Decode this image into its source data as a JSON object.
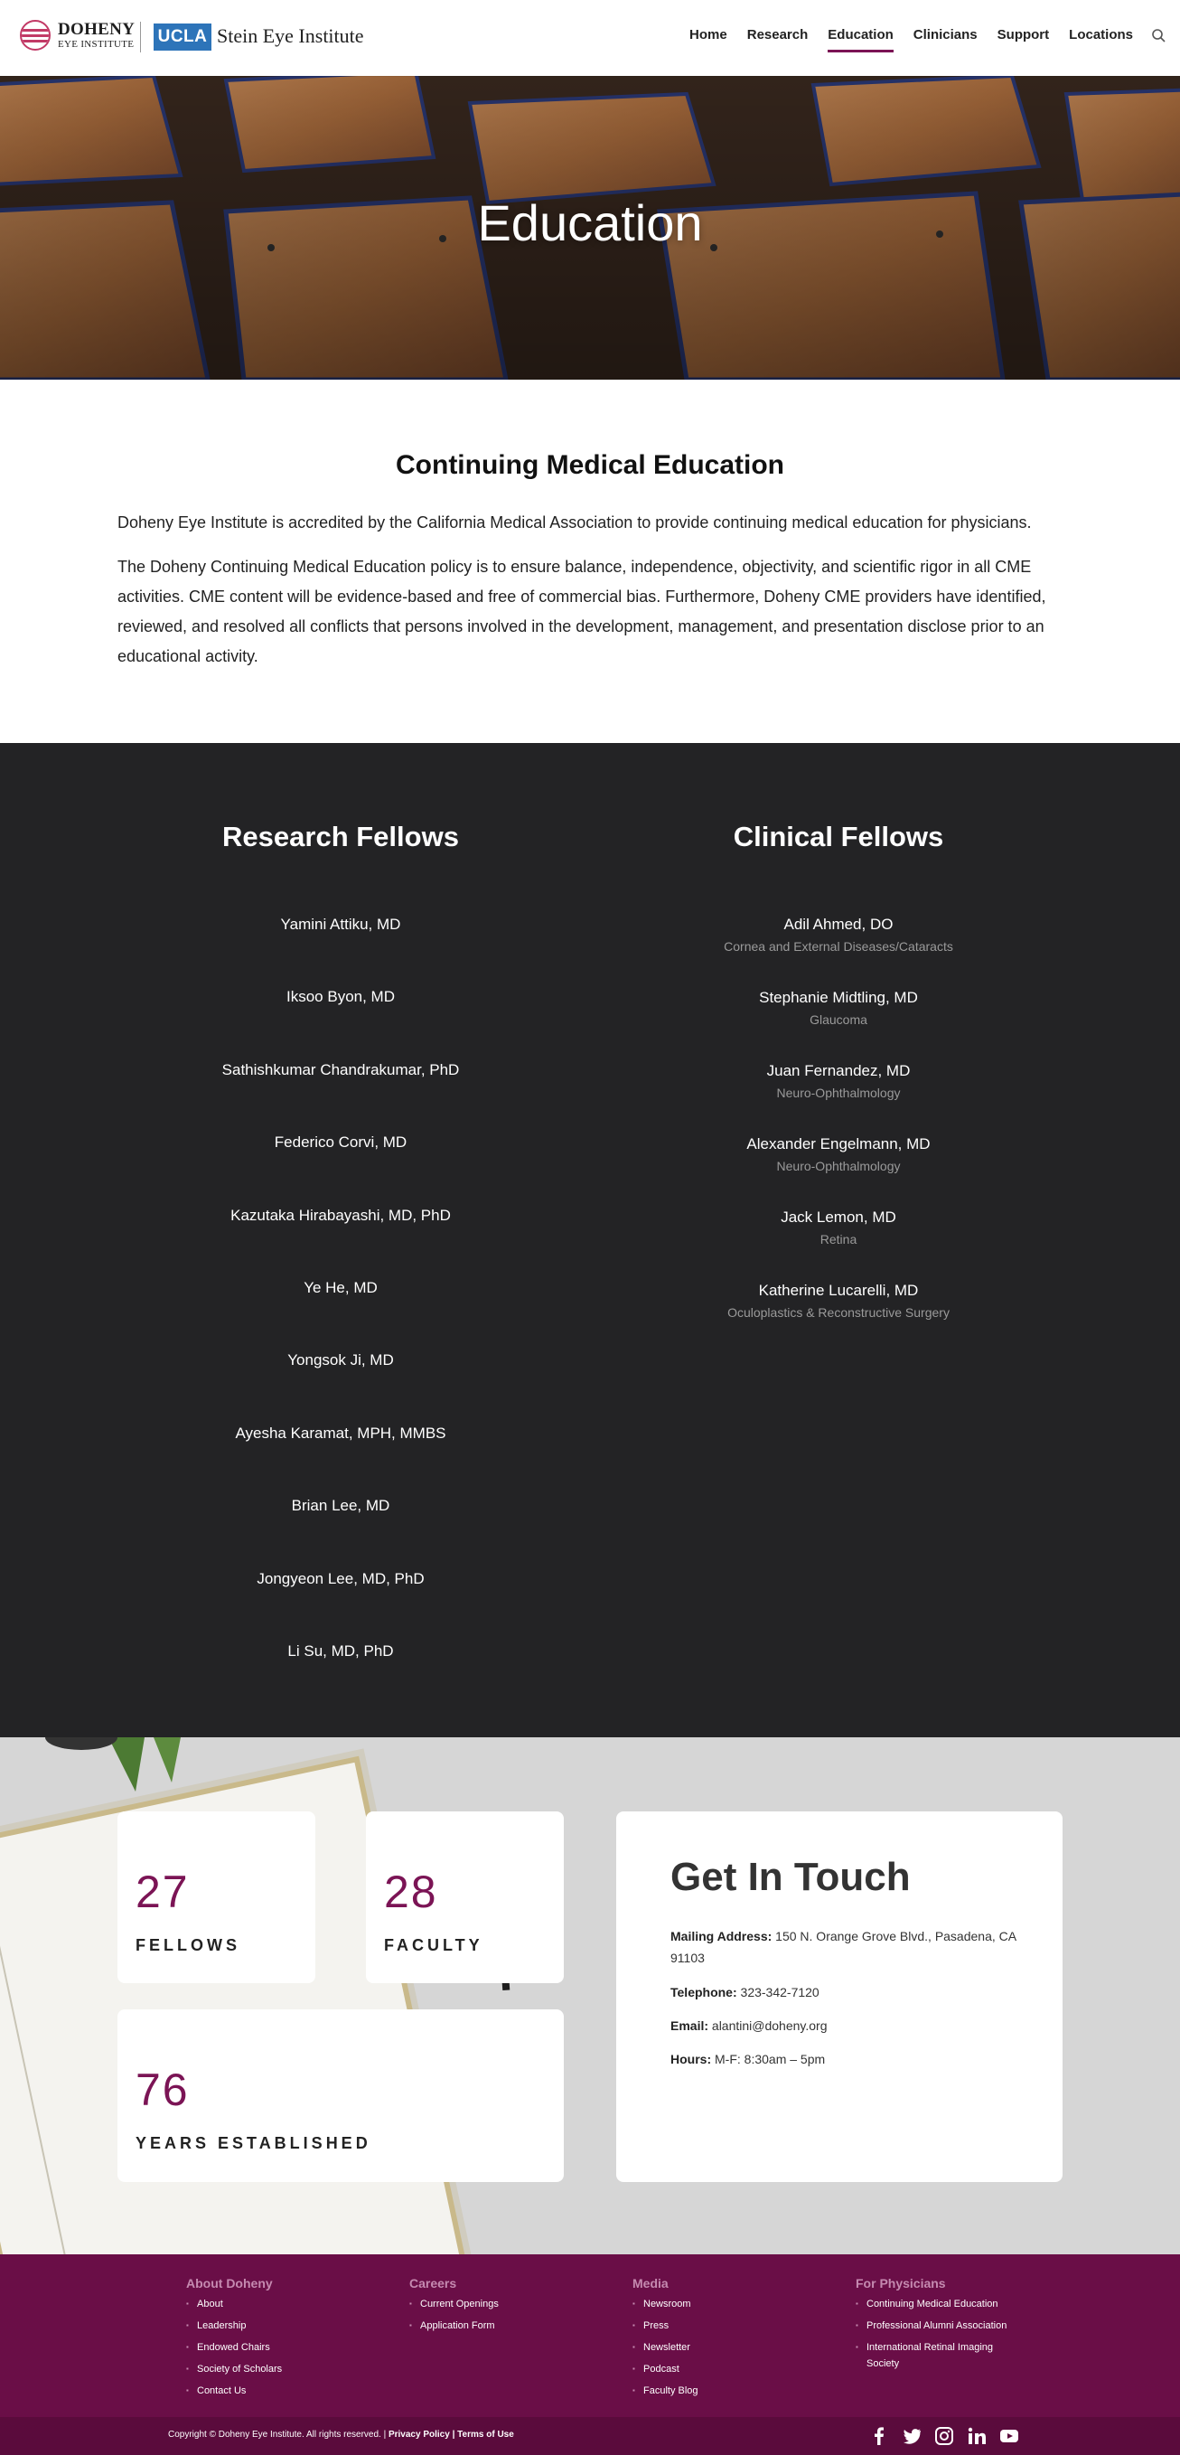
{
  "header": {
    "logo_line1": "DOHENY",
    "logo_line2": "EYE INSTITUTE",
    "ucla": "UCLA",
    "stein": "Stein Eye Institute",
    "nav": [
      "Home",
      "Research",
      "Education",
      "Clinicians",
      "Support",
      "Locations"
    ],
    "active_nav": "Education"
  },
  "hero": {
    "title": "Education"
  },
  "cme": {
    "title": "Continuing Medical Education",
    "p1": "Doheny Eye Institute is accredited by the California Medical Association to provide continuing medical education for physicians.",
    "p2": "The Doheny Continuing Medical Education policy is to ensure balance, independence, objectivity, and scientific rigor in all CME activities. CME content will be evidence-based and free of commercial bias. Furthermore, Doheny CME providers have identified, reviewed, and resolved all conflicts that persons involved in the development, management, and presentation disclose prior to an educational activity."
  },
  "research_fellows": {
    "title": "Research Fellows",
    "names": [
      "Yamini Attiku, MD",
      "Iksoo Byon, MD",
      "Sathishkumar Chandrakumar, PhD",
      "Federico Corvi, MD",
      "Kazutaka Hirabayashi, MD, PhD",
      "Ye He, MD",
      "Yongsok Ji, MD",
      "Ayesha Karamat, MPH, MMBS",
      "Brian Lee, MD",
      "Jongyeon Lee, MD, PhD",
      "Li Su, MD, PhD"
    ]
  },
  "clinical_fellows": {
    "title": "Clinical Fellows",
    "items": [
      {
        "name": "Adil Ahmed, DO",
        "specialty": "Cornea and External Diseases/Cataracts"
      },
      {
        "name": "Stephanie Midtling, MD",
        "specialty": "Glaucoma"
      },
      {
        "name": "Juan Fernandez, MD",
        "specialty": "Neuro-Ophthalmology"
      },
      {
        "name": "Alexander Engelmann, MD",
        "specialty": "Neuro-Ophthalmology"
      },
      {
        "name": "Jack Lemon, MD",
        "specialty": "Retina"
      },
      {
        "name": "Katherine Lucarelli, MD",
        "specialty": "Oculoplastics & Reconstructive Surgery"
      }
    ]
  },
  "stats": {
    "fellows": {
      "number": "27",
      "label": "FELLOWS"
    },
    "faculty": {
      "number": "28",
      "label": "FACULTY"
    },
    "years": {
      "number": "76",
      "label": "YEARS ESTABLISHED"
    }
  },
  "contact": {
    "title": "Get In Touch",
    "mailing_label": "Mailing Address:",
    "mailing_value": "150 N. Orange Grove Blvd., Pasadena, CA 91103",
    "phone_label": "Telephone:",
    "phone_value": "323-342-7120",
    "email_label": "Email:",
    "email_value": "alantini@doheny.org",
    "hours_label": "Hours:",
    "hours_value": "M-F: 8:30am – 5pm"
  },
  "footer": {
    "columns": [
      {
        "title": "About Doheny",
        "links": [
          "About",
          "Leadership",
          "Endowed Chairs",
          "Society of Scholars",
          "Contact Us"
        ]
      },
      {
        "title": "Careers",
        "links": [
          "Current Openings",
          "Application Form"
        ]
      },
      {
        "title": "Media",
        "links": [
          "Newsroom",
          "Press",
          "Newsletter",
          "Podcast",
          "Faculty Blog"
        ]
      },
      {
        "title": "For Physicians",
        "links": [
          "Continuing Medical Education",
          "Professional Alumni Association",
          "International Retinal Imaging Society"
        ]
      }
    ],
    "copyright": "Copyright © Doheny Eye Institute. All rights reserved. |",
    "privacy": "Privacy Policy",
    "sep": "|",
    "terms": "Terms of Use",
    "social": [
      "facebook-icon",
      "twitter-icon",
      "instagram-icon",
      "linkedin-icon",
      "youtube-icon"
    ]
  },
  "colors": {
    "brand": "#7b1455",
    "footer": "#6a0e47",
    "dark_section": "#232325",
    "ucla_blue": "#2d74b9"
  }
}
